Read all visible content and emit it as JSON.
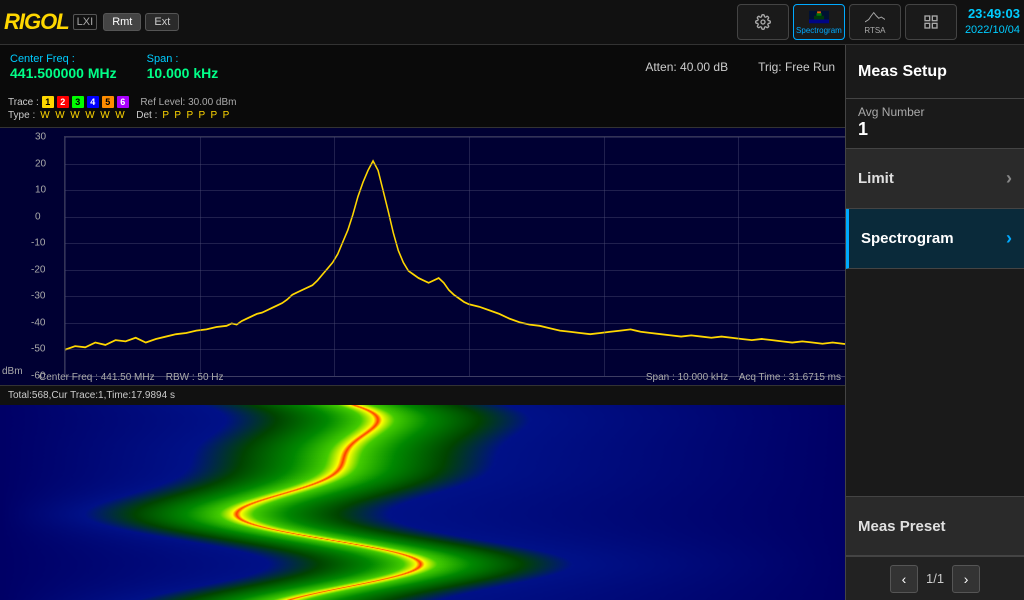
{
  "header": {
    "logo": "RIGOL",
    "lxi_label": "LXI",
    "rmt_label": "Rmt",
    "ext_label": "Ext",
    "clock": "23:49:03",
    "date": "2022/10/04"
  },
  "toolbar": {
    "icons": [
      {
        "id": "settings",
        "label": "",
        "active": false
      },
      {
        "id": "spectrogram",
        "label": "Spectrogram",
        "active": true
      },
      {
        "id": "rtsa",
        "label": "RTSA",
        "active": false
      },
      {
        "id": "grid",
        "label": "",
        "active": false
      }
    ]
  },
  "freq_display": {
    "center_label": "Center Freq :",
    "center_value": "441.500000 MHz",
    "span_label": "Span :",
    "span_value": "10.000 kHz"
  },
  "trace_info": {
    "trace_label": "Trace :",
    "type_label": "Type :",
    "det_label": "Det :",
    "numbers": [
      "1",
      "2",
      "3",
      "4",
      "5",
      "6"
    ],
    "types": [
      "W",
      "W",
      "W",
      "W",
      "W",
      "W"
    ],
    "dets": [
      "P",
      "P",
      "P",
      "P",
      "P",
      "P"
    ]
  },
  "atten": {
    "atten_label": "Atten: 40.00 dB",
    "ref_level_label": "Ref Level: 30.00 dBm",
    "trig_label": "Trig: Free Run"
  },
  "spectrum": {
    "y_labels": [
      "30",
      "20",
      "10",
      "0",
      "-10",
      "-20",
      "-30",
      "-40",
      "-50",
      "-60"
    ],
    "dbm_label": "dBm",
    "bottom_left": "Center Freq : 441.50 MHz",
    "bottom_right_span": "Span : 10.000 kHz",
    "bottom_left2": "RBW : 50 Hz",
    "bottom_right2": "Acq Time : 31.6715 ms"
  },
  "spectrogram": {
    "status_label": "Total:568,Cur Trace:1,Time:17.9894 s"
  },
  "right_panel": {
    "title": "Meas Setup",
    "avg_number_label": "Avg Number",
    "avg_number_value": "1",
    "buttons": [
      {
        "label": "Limit",
        "has_arrow": true,
        "active": false
      },
      {
        "label": "Spectrogram",
        "has_arrow": true,
        "active": true
      },
      {
        "label": "Meas Preset",
        "has_arrow": false,
        "active": false
      }
    ],
    "pagination": {
      "current": "1",
      "total": "1"
    }
  }
}
